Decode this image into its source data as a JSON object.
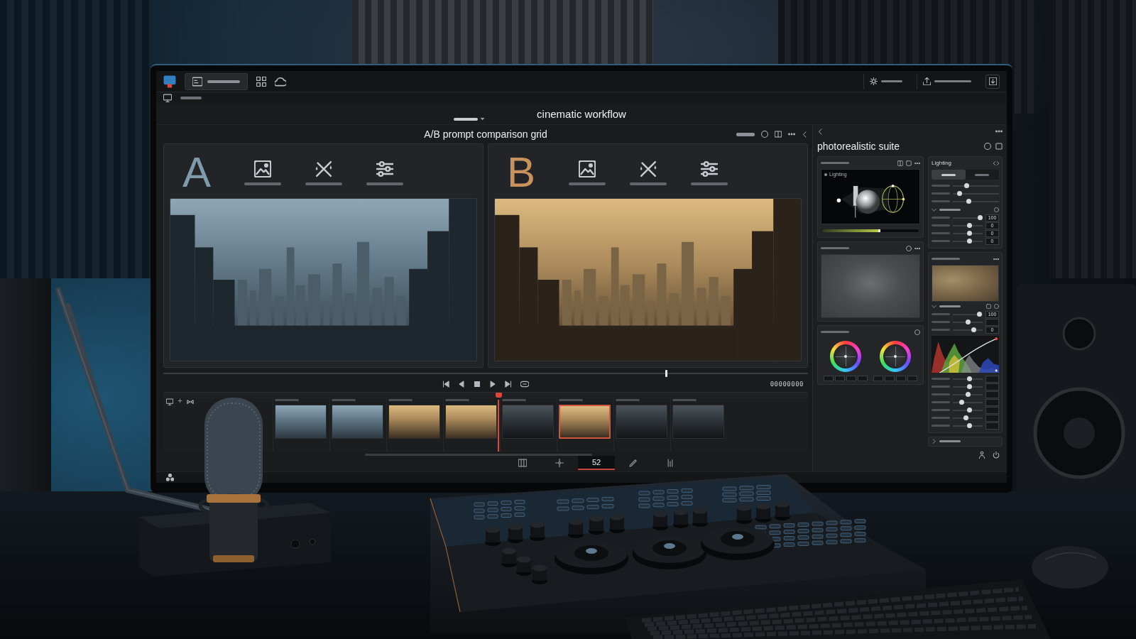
{
  "window": {
    "title": "cinematic workflow"
  },
  "comparison": {
    "title": "A/B prompt comparison grid",
    "panels": [
      {
        "letter": "A",
        "color": "#7f9aab",
        "kind": "cool"
      },
      {
        "letter": "B",
        "color": "#c8925c",
        "kind": "warm"
      }
    ]
  },
  "transport": {
    "scrubber": {
      "level": 0.78
    },
    "timecode": "00000000"
  },
  "timeline": {
    "playhead": {
      "level": 0.52
    },
    "clips": [
      {
        "kind": "cool",
        "selected": false
      },
      {
        "kind": "cool",
        "selected": false
      },
      {
        "kind": "warm",
        "selected": false
      },
      {
        "kind": "warm",
        "selected": false
      },
      {
        "kind": "dark",
        "selected": false
      },
      {
        "kind": "warm",
        "selected": true
      },
      {
        "kind": "dark",
        "selected": false
      },
      {
        "kind": "dark",
        "selected": false
      }
    ]
  },
  "page_tabs": [
    {
      "selected": false
    },
    {
      "selected": false
    },
    {
      "label": "52",
      "selected": true
    },
    {
      "selected": false
    },
    {
      "selected": false
    }
  ],
  "inspector": {
    "title": "photorealistic suite",
    "viewport": {
      "label": "Lighting",
      "light": {
        "level": 0.6
      }
    },
    "lighting": {
      "title": "Lighting",
      "modes": [
        {
          "selected": true
        },
        {
          "selected": false
        }
      ],
      "sliders": [
        {
          "level": 0.3
        },
        {
          "level": 0.15
        },
        {
          "level": 0.35
        }
      ],
      "section": {
        "expanded": true,
        "sliders": [
          {
            "level": 0.92,
            "value": "100"
          },
          {
            "level": 0.55,
            "value": "0"
          },
          {
            "level": 0.55,
            "value": "0"
          },
          {
            "level": 0.55,
            "value": "0"
          }
        ]
      }
    },
    "texture": {
      "section": {
        "expanded": true,
        "sliders": [
          {
            "level": 0.9,
            "value": "100"
          },
          {
            "level": 0.5
          },
          {
            "level": 0.7,
            "value": "0"
          }
        ]
      },
      "adjustments": [
        {
          "level": 0.55
        },
        {
          "level": 0.55
        },
        {
          "level": 0.5
        },
        {
          "level": 0.3
        },
        {
          "level": 0.55
        },
        {
          "level": 0.45
        },
        {
          "level": 0.55
        }
      ]
    },
    "footer": {
      "expanded": false
    }
  }
}
